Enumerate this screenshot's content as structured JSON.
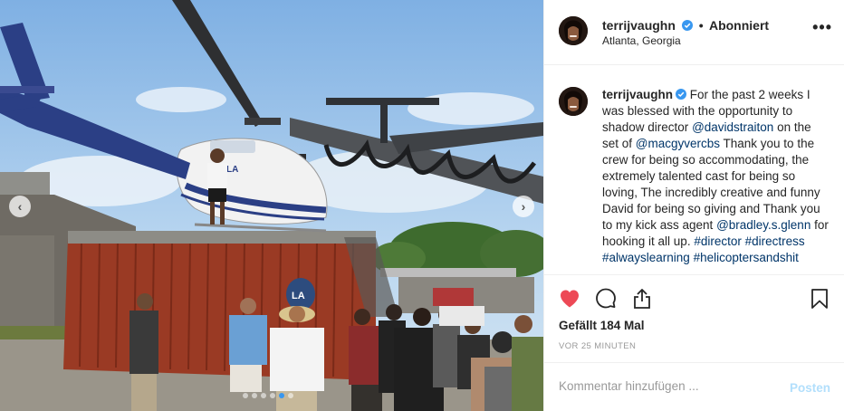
{
  "photo": {
    "nav_prev": "‹",
    "nav_next": "›",
    "carousel_dots": 6,
    "active_dot": 4,
    "container_mark": "LA",
    "heli_mark": "LA"
  },
  "header": {
    "username": "terrijvaughn",
    "separator": "•",
    "follow_status": "Abonniert",
    "location": "Atlanta, Georgia",
    "more": "•••"
  },
  "caption": {
    "username": "terrijvaughn",
    "segments": [
      {
        "type": "text",
        "text": " For the past 2 weeks I was blessed with the opportunity to shadow director "
      },
      {
        "type": "tag",
        "text": "@davidstraiton"
      },
      {
        "type": "text",
        "text": " on the set of "
      },
      {
        "type": "tag",
        "text": "@macgyvercbs"
      },
      {
        "type": "text",
        "text": " Thank you to the crew for being so accommodating, the extremely talented cast for being so loving, The incredibly creative and funny David for being so giving and Thank you to my kick ass agent "
      },
      {
        "type": "tag",
        "text": "@bradley.s.glenn"
      },
      {
        "type": "text",
        "text": " for hooking it all up. "
      },
      {
        "type": "tag",
        "text": "#director"
      },
      {
        "type": "text",
        "text": " "
      },
      {
        "type": "tag",
        "text": "#directress"
      },
      {
        "type": "text",
        "text": " "
      },
      {
        "type": "tag",
        "text": "#alwayslearning"
      },
      {
        "type": "text",
        "text": " "
      },
      {
        "type": "tag",
        "text": "#helicoptersandshit"
      }
    ]
  },
  "actions": {
    "like_icon": "heart-filled-icon",
    "comment_icon": "comment-icon",
    "share_icon": "share-icon",
    "save_icon": "bookmark-icon",
    "like_color": "#ed4956"
  },
  "likes": "Gefällt 184 Mal",
  "timestamp": "VOR 25 MINUTEN",
  "comment": {
    "placeholder": "Kommentar hinzufügen ...",
    "post_label": "Posten"
  },
  "colors": {
    "verified": "#3897f0",
    "link": "#003569",
    "container": "#9a3a24"
  }
}
